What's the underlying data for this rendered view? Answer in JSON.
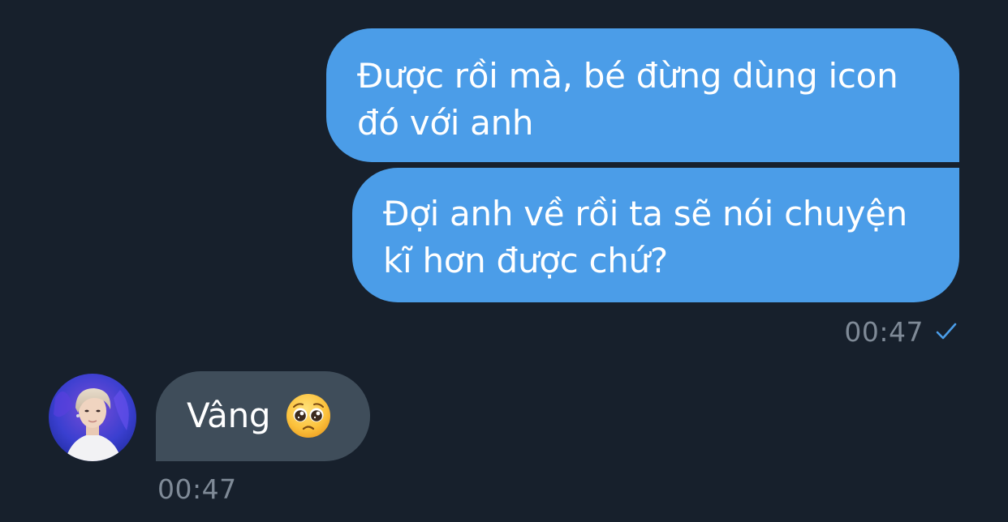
{
  "messages": [
    {
      "direction": "outgoing",
      "lines": [
        "Được rồi mà, bé đừng dùng icon",
        "đó với anh"
      ]
    },
    {
      "direction": "outgoing",
      "lines": [
        "Đợi anh về rồi ta sẽ nói chuyện",
        "kĩ hơn được chứ?"
      ]
    },
    {
      "direction": "incoming",
      "text": "Vâng",
      "emoji": "pleading-face-emoji"
    }
  ],
  "outgoing_time": "00:47",
  "incoming_time": "00:47",
  "icons": {
    "sent_status": "check-icon",
    "avatar": "contact-avatar"
  },
  "colors": {
    "background": "#17202c",
    "outgoing_bubble": "#4b9de8",
    "incoming_bubble": "#3f4d5a",
    "timestamp": "#7f8a97",
    "check": "#4b9de8"
  }
}
